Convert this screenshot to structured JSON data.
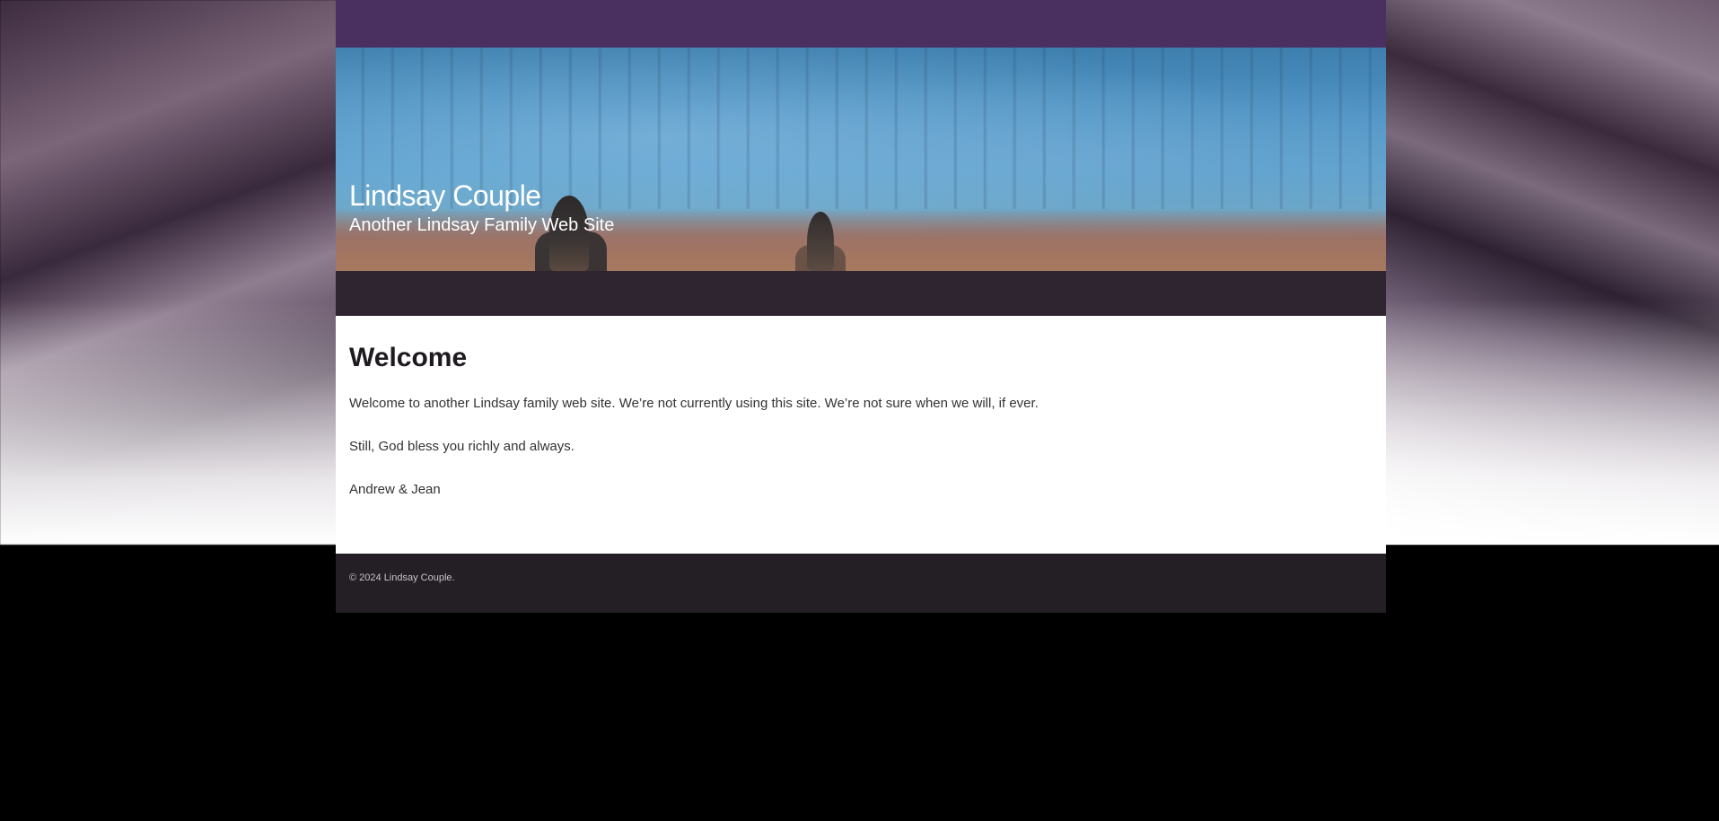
{
  "site": {
    "title": "Lindsay Couple",
    "tagline": "Another Lindsay Family Web Site"
  },
  "main": {
    "heading": "Welcome",
    "paragraphs": [
      "Welcome to another Lindsay family web site.  We’re not currently using this site.  We’re not sure when we will, if ever.",
      "Still, God bless you richly and always.",
      "Andrew & Jean"
    ]
  },
  "footer": {
    "copyright": "© 2024 Lindsay Couple."
  },
  "colors": {
    "topbar": "#4a3060",
    "navbar": "#2f2530",
    "footer": "#231f24",
    "page_background": "#000000"
  }
}
